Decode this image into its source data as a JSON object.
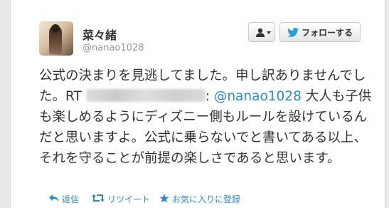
{
  "tweet": {
    "display_name": "菜々緒",
    "screen_name": "@nanao1028",
    "text_part1": "公式の決まりを見逃してました。申し訳ありませんでした。RT ",
    "text_colon": ": ",
    "mention": "@nanao1028",
    "text_part2": " 大人も子供も楽しめるようにディズニー側もルールを設けているんだと思いますよ。公式に乗らないでと書いてある以上、それを守ることが前提の楽しさであると思います。"
  },
  "buttons": {
    "follow_label": "フォローする"
  },
  "actions": {
    "reply": "返信",
    "retweet": "リツイート",
    "favorite": "お気に入りに登録"
  },
  "colors": {
    "link": "#2a8bc9",
    "text": "#333333",
    "muted": "#999999",
    "background": "#e9e9e9"
  },
  "icons": [
    "person-icon",
    "twitter-bird-icon",
    "reply-icon",
    "retweet-icon",
    "star-icon"
  ]
}
